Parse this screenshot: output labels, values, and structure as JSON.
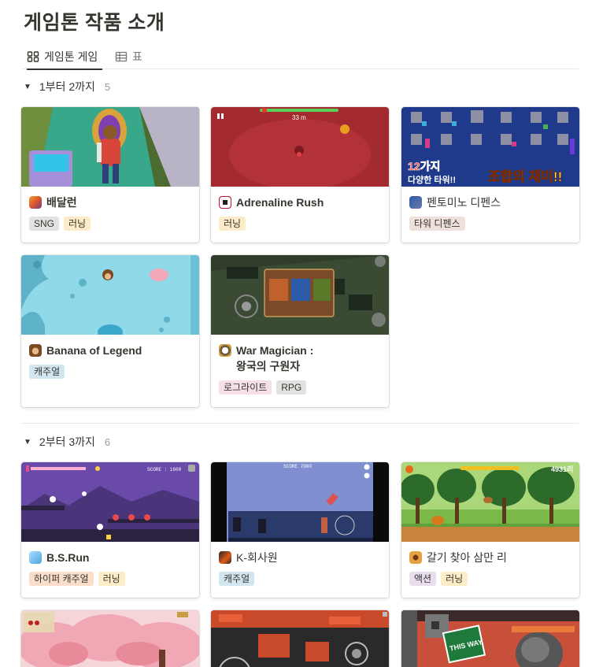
{
  "page": {
    "title": "게임톤 작품 소개"
  },
  "view_tabs": [
    {
      "label": "게임톤 게임",
      "icon": "gallery-icon",
      "active": true
    },
    {
      "label": "표",
      "icon": "table-icon",
      "active": false
    }
  ],
  "groups": [
    {
      "label": "1부터 2까지",
      "count": "5",
      "cards": [
        {
          "title": "배달런",
          "icon_color": "#d9562b",
          "tags": [
            {
              "label": "SNG",
              "color": "gray"
            },
            {
              "label": "러닝",
              "color": "yellow"
            }
          ]
        },
        {
          "title": "Adrenaline Rush",
          "icon_color": "#c8102e",
          "tags": [
            {
              "label": "러닝",
              "color": "yellow"
            }
          ]
        },
        {
          "title": "펜토미노 디펜스",
          "icon_color": "#3b4a7a",
          "tags": [
            {
              "label": "타워 디펜스",
              "color": "brown"
            }
          ]
        },
        {
          "title": "Banana of Legend",
          "icon_color": "#8a5a2b",
          "tags": [
            {
              "label": "캐주얼",
              "color": "blue"
            }
          ]
        },
        {
          "title": "War Magician :\n왕국의 구원자",
          "icon_color": "#6b5c4a",
          "tags": [
            {
              "label": "로그라이트",
              "color": "pink"
            },
            {
              "label": "RPG",
              "color": "gray"
            }
          ]
        }
      ]
    },
    {
      "label": "2부터 3까지",
      "count": "6",
      "cards": [
        {
          "title": "B.S.Run",
          "icon_color": "#4fa3e0",
          "tags": [
            {
              "label": "하이퍼 캐주얼",
              "color": "orange"
            },
            {
              "label": "러닝",
              "color": "yellow"
            }
          ]
        },
        {
          "title": "K-회사원",
          "icon_color": "#e05a1a",
          "tags": [
            {
              "label": "캐주얼",
              "color": "blue"
            }
          ]
        },
        {
          "title": "갈기 찾아 삼만 리",
          "icon_color": "#b0641e",
          "tags": [
            {
              "label": "액션",
              "color": "purple"
            },
            {
              "label": "러닝",
              "color": "yellow"
            }
          ]
        }
      ]
    }
  ],
  "cover_text": {
    "adrenaline_distance": "33 m",
    "pentomino_left": "12가지",
    "pentomino_left2": "다양한 타워!!",
    "pentomino_right": "조합의 재미!!",
    "bsrun_score": "SCORE : 1600",
    "kworker_score": "SCORE 7000",
    "galgi_distance": "4931리",
    "this_way": "THIS WAY"
  }
}
